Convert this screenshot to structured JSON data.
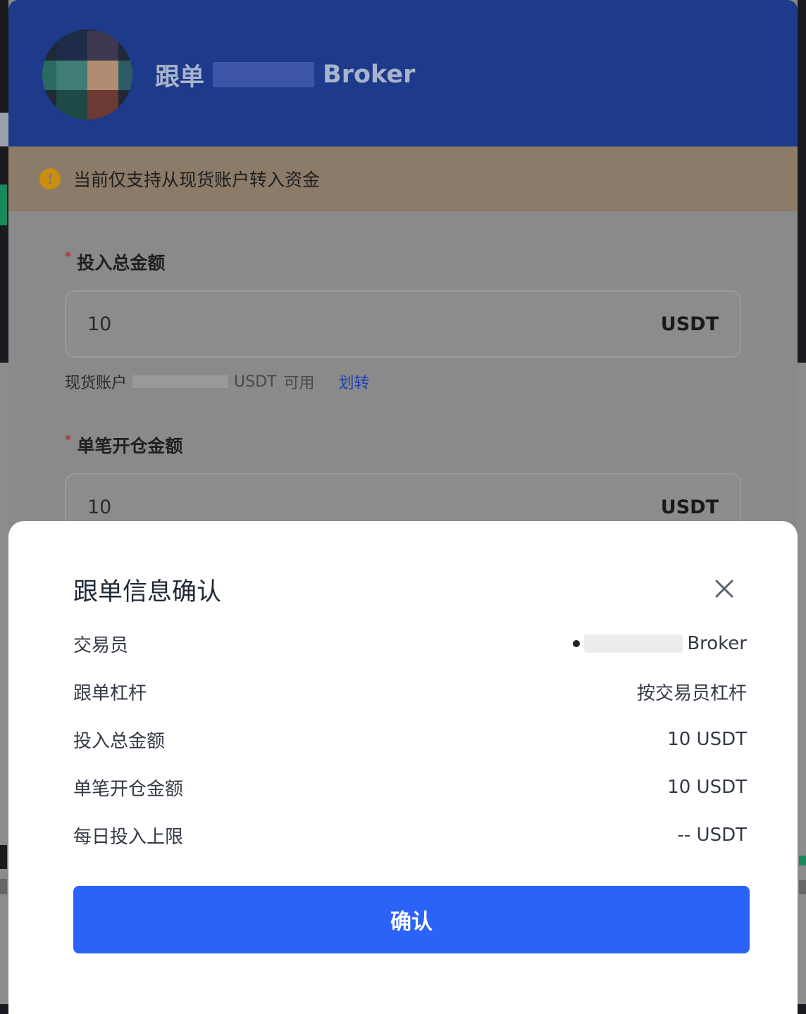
{
  "panel": {
    "title_prefix": "跟单",
    "title_suffix": "Broker",
    "notice": "当前仅支持从现货账户转入资金",
    "total_amount": {
      "label": "投入总金额",
      "value": "10",
      "unit": "USDT"
    },
    "available": {
      "prefix": "现货账户",
      "unit": "USDT",
      "suffix": "可用",
      "transfer_label": "划转"
    },
    "single_amount": {
      "label": "单笔开仓金额",
      "value": "10",
      "unit": "USDT"
    }
  },
  "dialog": {
    "title": "跟单信息确认",
    "rows": [
      {
        "label": "交易员",
        "value": "Broker"
      },
      {
        "label": "跟单杠杆",
        "value": "按交易员杠杆"
      },
      {
        "label": "投入总金额",
        "value": "10 USDT"
      },
      {
        "label": "单笔开仓金额",
        "value": "10 USDT"
      },
      {
        "label": "每日投入上限",
        "value": "-- USDT"
      }
    ],
    "confirm_label": "确认"
  },
  "colors": {
    "primary": "#2b63f8",
    "header": "#1e3a8a",
    "warning": "#c98f10"
  },
  "icons": {
    "warning": "warning-circle-icon",
    "close": "close-icon"
  }
}
